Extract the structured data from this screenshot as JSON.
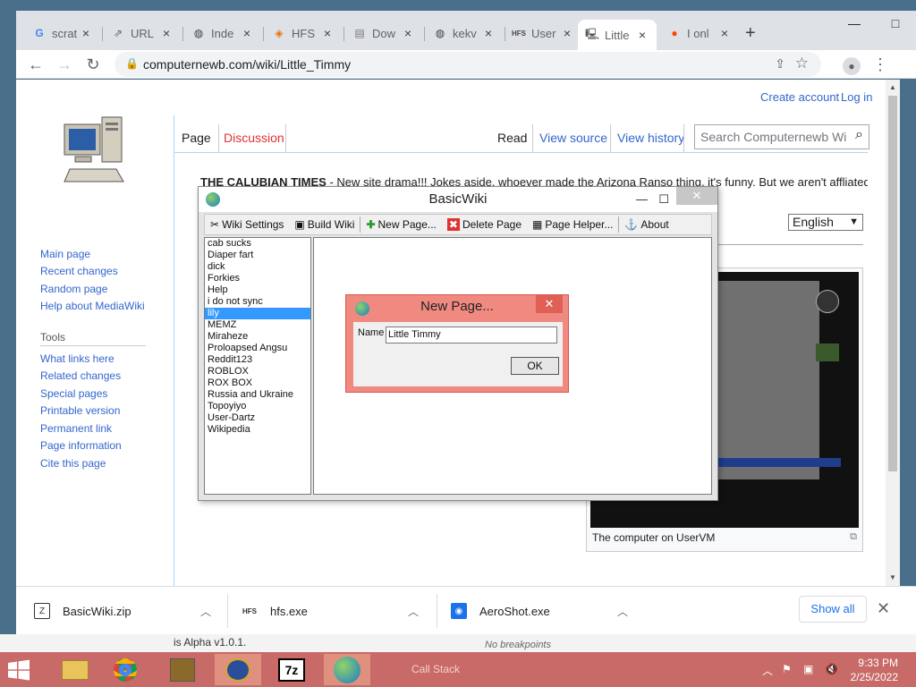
{
  "browser": {
    "tabs": [
      {
        "label": "scrat",
        "favicon": "google-icon"
      },
      {
        "label": "URL",
        "favicon": "link-icon"
      },
      {
        "label": "Inde",
        "favicon": "globe-icon"
      },
      {
        "label": "HFS",
        "favicon": "diamond-icon"
      },
      {
        "label": "Dow",
        "favicon": "file-icon"
      },
      {
        "label": "kekv",
        "favicon": "globe-icon"
      },
      {
        "label": "User",
        "favicon": "hfs-icon"
      },
      {
        "label": "Little",
        "favicon": "computer-icon"
      },
      {
        "label": "I onl",
        "favicon": "reddit-icon"
      }
    ],
    "url": "computernewb.com/wiki/Little_Timmy"
  },
  "wiki": {
    "personal": {
      "create": "Create account",
      "login": "Log in"
    },
    "nav": [
      "Main page",
      "Recent changes",
      "Random page",
      "Help about MediaWiki"
    ],
    "tools_heading": "Tools",
    "tools": [
      "What links here",
      "Related changes",
      "Special pages",
      "Printable version",
      "Permanent link",
      "Page information",
      "Cite this page"
    ],
    "tabs": {
      "page": "Page",
      "discussion": "Discussion",
      "read": "Read",
      "view_source": "View source",
      "view_history": "View history"
    },
    "search_placeholder": "Search Computernewb Wiki",
    "notice_bold": "THE CALUBIAN TIMES",
    "notice_text": " - New site drama!!! Jokes aside, whoever made the Arizona Ranso thing, it's funny. But we aren't affliated",
    "language": "English",
    "thumb_caption": "The computer on UserVM"
  },
  "basicwiki": {
    "title": "BasicWiki",
    "menu": [
      {
        "label": "Wiki Settings",
        "icon": "tools-icon"
      },
      {
        "label": "Build Wiki",
        "icon": "build-icon"
      },
      {
        "label": "New Page...",
        "icon": "plus-icon"
      },
      {
        "label": "Delete Page",
        "icon": "delete-icon"
      },
      {
        "label": "Page Helper...",
        "icon": "helper-icon"
      },
      {
        "label": "About",
        "icon": "about-icon"
      }
    ],
    "pages": [
      "cab sucks",
      "Diaper fart",
      "dick",
      "Forkies",
      "Help",
      "i do not sync",
      "lily",
      "MEMZ",
      "Miraheze",
      "Proloapsed Angsu",
      "Reddit123",
      "ROBLOX",
      "ROX BOX",
      "Russia and Ukraine",
      "Topoyiyo",
      "User-Dartz",
      "Wikipedia"
    ],
    "selected_index": 6
  },
  "dialog": {
    "title": "New Page...",
    "name_label": "Name",
    "name_value": "Little Timmy",
    "ok_label": "OK"
  },
  "downloads": {
    "items": [
      "BasicWiki.zip",
      "hfs.exe",
      "AeroShot.exe"
    ],
    "show_all": "Show all"
  },
  "background": {
    "alpha_text": "is Alpha v1.0.1.",
    "no_breakpoints": "No breakpoints",
    "call_stack": "Call Stack"
  },
  "taskbar": {
    "time": "9:33 PM",
    "date": "2/25/2022",
    "color": "#c86a67"
  }
}
